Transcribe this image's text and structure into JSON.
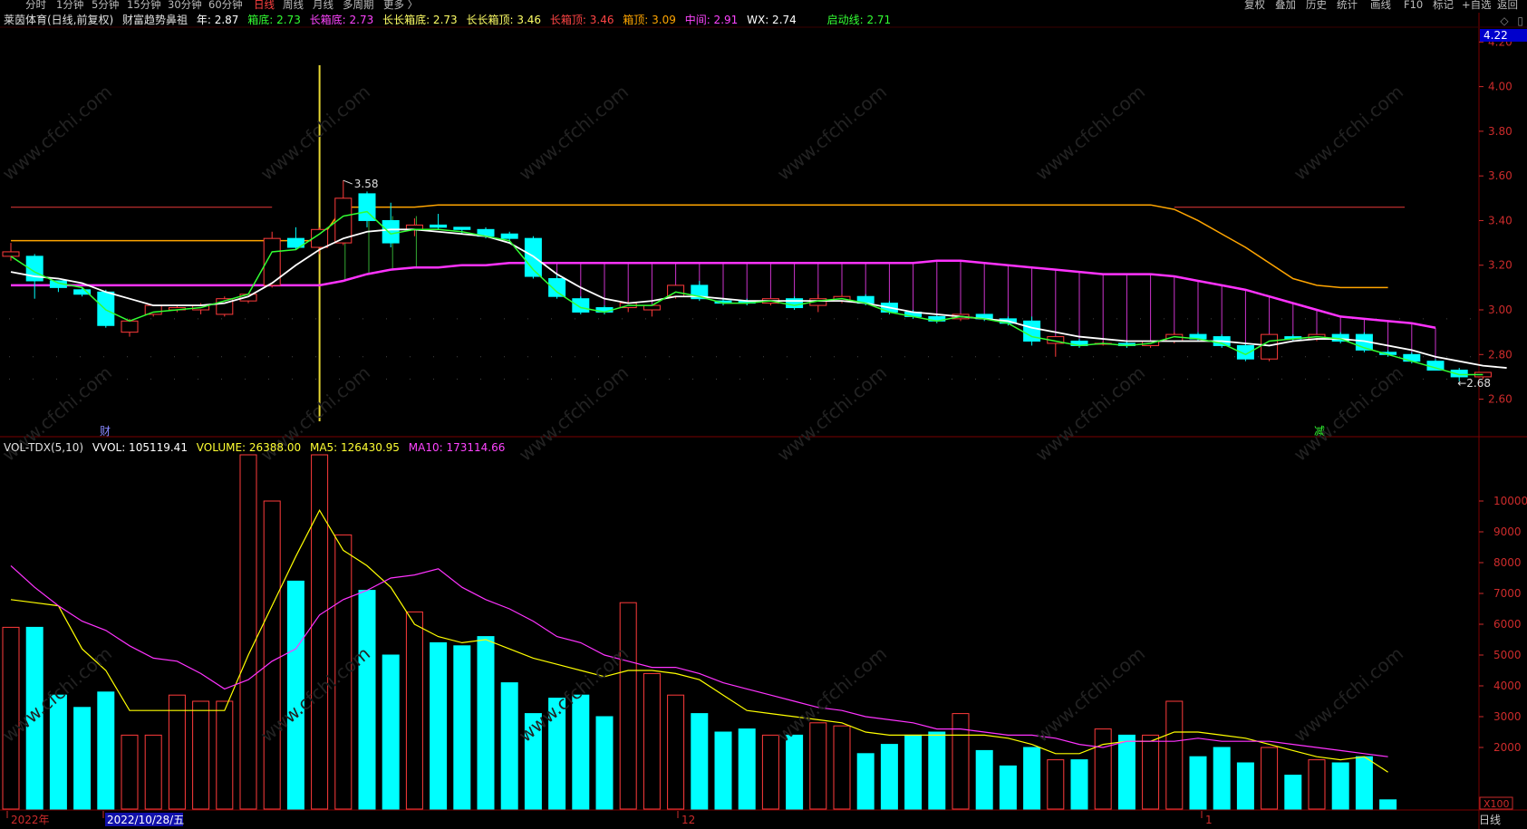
{
  "toolbar": {
    "left_items": [
      {
        "label": "分时",
        "x": 28
      },
      {
        "label": "1分钟",
        "x": 62
      },
      {
        "label": "5分钟",
        "x": 101
      },
      {
        "label": "15分钟",
        "x": 140
      },
      {
        "label": "30分钟",
        "x": 185
      },
      {
        "label": "60分钟",
        "x": 230
      },
      {
        "label": "日线",
        "x": 280,
        "active": true
      },
      {
        "label": "周线",
        "x": 312
      },
      {
        "label": "月线",
        "x": 345
      },
      {
        "label": "多周期",
        "x": 378
      },
      {
        "label": "更多 〉",
        "x": 423
      }
    ],
    "right_items": [
      {
        "label": "复权",
        "x": 1373
      },
      {
        "label": "叠加",
        "x": 1407
      },
      {
        "label": "历史",
        "x": 1441
      },
      {
        "label": "统计",
        "x": 1475
      },
      {
        "label": "画线",
        "x": 1512
      },
      {
        "label": "F10",
        "x": 1549
      },
      {
        "label": "标记",
        "x": 1581
      },
      {
        "label": "+自选",
        "x": 1613
      },
      {
        "label": "返回",
        "x": 1652
      }
    ]
  },
  "info": {
    "stock": "莱茵体育(日线,前复权)",
    "indicator": "财富趋势鼻祖",
    "year": "年: 2.87",
    "xiangdi": "箱底: 2.73",
    "long_xiangdi": "长箱底: 2.73",
    "longlong_xiangdi": "长长箱底: 2.73",
    "longlong_xiangding": "长长箱顶: 3.46",
    "long_xiangding": "长箱顶: 3.46",
    "xiangding": "箱顶: 3.09",
    "zhongjian": "中间: 2.91",
    "wx": "WX: 2.74",
    "qidong": "启动线: 2.71"
  },
  "vol_info": {
    "name": "VOL-TDX(5,10)",
    "vvol": "VVOL: 105119.41",
    "volume": "VOLUME: 26388.00",
    "ma5": "MA5: 126430.95",
    "ma10": "MA10: 173114.66"
  },
  "window_icons": [
    "diamond-icon",
    "restore-icon"
  ],
  "colors": {
    "bg": "#000000",
    "up": "#ff3b3b",
    "down": "#00ffff",
    "grid": "#5a0000",
    "white_line": "#ffffff",
    "green_line": "#33ff33",
    "orange_line": "#ffa500",
    "magenta_line": "#ff33ff",
    "darkred_line": "#cc3333",
    "yellow_line": "#ffff00",
    "axis_text": "#cc2b2b"
  },
  "chart_data": {
    "type": "candlestick",
    "price_axis": {
      "ticks": [
        "4.20",
        "4.00",
        "3.80",
        "3.60",
        "3.40",
        "3.20",
        "3.00",
        "2.80",
        "2.60"
      ],
      "ylim": [
        2.44,
        4.25
      ],
      "current_label": "4.22"
    },
    "volume_axis": {
      "ticks": [
        "10000",
        "9000",
        "8000",
        "7000",
        "6000",
        "5000",
        "4000",
        "3000",
        "2000"
      ],
      "unit": "X100",
      "ylim": [
        0,
        11500
      ]
    },
    "annotations": {
      "high": "3.58",
      "low": "2.68",
      "mark_left": "财",
      "mark_right": "减"
    },
    "date_labels": [
      "2022年",
      "2022/10/28/五",
      "12",
      "1"
    ],
    "timeframe": "日线",
    "candles": [
      [
        3.24,
        3.3,
        3.26,
        3.22
      ],
      [
        3.24,
        3.25,
        3.13,
        3.05
      ],
      [
        3.13,
        3.13,
        3.1,
        3.08
      ],
      [
        3.09,
        3.1,
        3.07,
        3.06
      ],
      [
        3.08,
        3.09,
        2.93,
        2.92
      ],
      [
        2.9,
        2.96,
        2.95,
        2.88
      ],
      [
        2.98,
        3.01,
        3.02,
        2.97
      ],
      [
        3.0,
        3.02,
        3.01,
        2.99
      ],
      [
        3.0,
        3.03,
        3.02,
        2.98
      ],
      [
        2.98,
        3.06,
        3.05,
        2.97
      ],
      [
        3.04,
        3.07,
        3.07,
        3.03
      ],
      [
        3.11,
        3.35,
        3.32,
        3.1
      ],
      [
        3.32,
        3.37,
        3.28,
        3.27
      ],
      [
        3.28,
        3.37,
        3.36,
        3.25
      ],
      [
        3.3,
        3.58,
        3.5,
        3.29
      ],
      [
        3.52,
        3.53,
        3.4,
        3.37
      ],
      [
        3.4,
        3.48,
        3.3,
        3.28
      ],
      [
        3.36,
        3.41,
        3.38,
        3.33
      ],
      [
        3.38,
        3.43,
        3.37,
        3.36
      ],
      [
        3.37,
        3.37,
        3.36,
        3.34
      ],
      [
        3.36,
        3.37,
        3.33,
        3.32
      ],
      [
        3.34,
        3.35,
        3.32,
        3.3
      ],
      [
        3.32,
        3.33,
        3.15,
        3.14
      ],
      [
        3.14,
        3.16,
        3.06,
        3.05
      ],
      [
        3.05,
        3.06,
        2.99,
        2.98
      ],
      [
        3.01,
        3.02,
        2.99,
        2.98
      ],
      [
        3.01,
        3.04,
        3.03,
        2.99
      ],
      [
        3.0,
        3.01,
        3.02,
        2.97
      ],
      [
        3.06,
        3.07,
        3.11,
        3.05
      ],
      [
        3.11,
        3.13,
        3.05,
        3.04
      ],
      [
        3.04,
        3.05,
        3.03,
        3.02
      ],
      [
        3.04,
        3.05,
        3.03,
        3.02
      ],
      [
        3.03,
        3.05,
        3.05,
        3.02
      ],
      [
        3.05,
        3.06,
        3.01,
        3.0
      ],
      [
        3.02,
        3.07,
        3.05,
        2.99
      ],
      [
        3.04,
        3.07,
        3.06,
        3.03
      ],
      [
        3.06,
        3.07,
        3.03,
        3.02
      ],
      [
        3.03,
        3.04,
        2.99,
        2.98
      ],
      [
        2.99,
        3.0,
        2.97,
        2.96
      ],
      [
        2.97,
        2.98,
        2.95,
        2.94
      ],
      [
        2.96,
        2.97,
        2.98,
        2.95
      ],
      [
        2.98,
        2.98,
        2.96,
        2.95
      ],
      [
        2.96,
        2.97,
        2.94,
        2.93
      ],
      [
        2.95,
        2.97,
        2.86,
        2.84
      ],
      [
        2.85,
        2.87,
        2.88,
        2.79
      ],
      [
        2.86,
        2.87,
        2.84,
        2.83
      ],
      [
        2.85,
        2.86,
        2.85,
        2.84
      ],
      [
        2.85,
        2.86,
        2.84,
        2.83
      ],
      [
        2.84,
        2.85,
        2.86,
        2.83
      ],
      [
        2.86,
        2.9,
        2.89,
        2.85
      ],
      [
        2.89,
        2.9,
        2.87,
        2.86
      ],
      [
        2.88,
        2.89,
        2.84,
        2.83
      ],
      [
        2.84,
        2.85,
        2.78,
        2.77
      ],
      [
        2.78,
        2.79,
        2.89,
        2.77
      ],
      [
        2.88,
        2.89,
        2.87,
        2.86
      ],
      [
        2.87,
        2.88,
        2.89,
        2.86
      ],
      [
        2.89,
        2.9,
        2.86,
        2.85
      ],
      [
        2.89,
        2.9,
        2.82,
        2.81
      ],
      [
        2.81,
        2.82,
        2.8,
        2.79
      ],
      [
        2.8,
        2.81,
        2.77,
        2.76
      ],
      [
        2.77,
        2.78,
        2.73,
        2.73
      ],
      [
        2.73,
        2.74,
        2.7,
        2.68
      ],
      [
        2.7,
        2.71,
        2.72,
        2.69
      ]
    ],
    "volumes": [
      5900,
      5900,
      3700,
      3300,
      3800,
      2400,
      2400,
      3700,
      3500,
      3500,
      11500,
      10000,
      7400,
      11500,
      8900,
      7100,
      5000,
      6400,
      5400,
      5300,
      5600,
      4100,
      3100,
      3600,
      3700,
      3000,
      6700,
      4400,
      3700,
      3100,
      2500,
      2600,
      2400,
      2400,
      2800,
      2700,
      1800,
      2100,
      2400,
      2500,
      3100,
      1900,
      1400,
      2000,
      1600,
      1600,
      2600,
      2400,
      2400,
      3500,
      1700,
      2000,
      1500,
      2000,
      1100,
      1600,
      1500,
      1700,
      300
    ],
    "ma5": [
      6800,
      6700,
      6600,
      5200,
      4500,
      3200,
      3200,
      3200,
      3200,
      3200,
      5000,
      6600,
      8200,
      9700,
      8400,
      7900,
      7200,
      6000,
      5600,
      5400,
      5500,
      5200,
      4900,
      4700,
      4500,
      4300,
      4500,
      4500,
      4400,
      4200,
      3700,
      3200,
      3100,
      3000,
      2900,
      2800,
      2500,
      2400,
      2400,
      2400,
      2400,
      2400,
      2300,
      2100,
      1800,
      1800,
      2100,
      2200,
      2200,
      2500,
      2500,
      2400,
      2300,
      2100,
      1900,
      1700,
      1600,
      1700,
      1200
    ],
    "ma10": [
      7900,
      7200,
      6600,
      6100,
      5800,
      5300,
      4900,
      4800,
      4400,
      3900,
      4200,
      4800,
      5200,
      6300,
      6800,
      7100,
      7500,
      7600,
      7800,
      7200,
      6800,
      6500,
      6100,
      5600,
      5400,
      5000,
      4800,
      4600,
      4600,
      4400,
      4100,
      3900,
      3700,
      3500,
      3300,
      3200,
      3000,
      2900,
      2800,
      2600,
      2600,
      2500,
      2400,
      2400,
      2300,
      2100,
      2000,
      2200,
      2200,
      2200,
      2300,
      2200,
      2200,
      2200,
      2100,
      2000,
      1900,
      1800,
      1700
    ],
    "white_line": [
      3.17,
      3.15,
      3.14,
      3.12,
      3.08,
      3.05,
      3.02,
      3.02,
      3.02,
      3.03,
      3.06,
      3.12,
      3.2,
      3.27,
      3.32,
      3.35,
      3.36,
      3.36,
      3.35,
      3.34,
      3.33,
      3.3,
      3.24,
      3.16,
      3.1,
      3.05,
      3.03,
      3.04,
      3.06,
      3.06,
      3.05,
      3.04,
      3.04,
      3.04,
      3.04,
      3.04,
      3.03,
      3.01,
      2.99,
      2.98,
      2.97,
      2.96,
      2.95,
      2.92,
      2.9,
      2.88,
      2.87,
      2.86,
      2.86,
      2.86,
      2.86,
      2.86,
      2.85,
      2.84,
      2.86,
      2.87,
      2.87,
      2.86,
      2.84,
      2.82,
      2.79,
      2.77,
      2.75,
      2.74
    ],
    "green_line": [
      3.24,
      3.17,
      3.12,
      3.1,
      3.0,
      2.95,
      2.99,
      3.0,
      3.01,
      3.04,
      3.07,
      3.26,
      3.27,
      3.34,
      3.42,
      3.44,
      3.34,
      3.36,
      3.36,
      3.35,
      3.33,
      3.31,
      3.18,
      3.08,
      3.01,
      2.99,
      3.02,
      3.02,
      3.08,
      3.06,
      3.03,
      3.03,
      3.04,
      3.02,
      3.04,
      3.05,
      3.03,
      2.99,
      2.97,
      2.95,
      2.97,
      2.96,
      2.94,
      2.88,
      2.86,
      2.84,
      2.85,
      2.84,
      2.85,
      2.88,
      2.87,
      2.85,
      2.8,
      2.86,
      2.87,
      2.88,
      2.87,
      2.83,
      2.8,
      2.77,
      2.74,
      2.71,
      2.71
    ],
    "orange_line": [
      3.31,
      3.31,
      3.31,
      3.31,
      3.31,
      3.31,
      3.31,
      3.31,
      3.31,
      3.31,
      3.31,
      3.31,
      3.31,
      3.31,
      3.46,
      3.46,
      3.46,
      3.46,
      3.47,
      3.47,
      3.47,
      3.47,
      3.47,
      3.47,
      3.47,
      3.47,
      3.47,
      3.47,
      3.47,
      3.47,
      3.47,
      3.47,
      3.47,
      3.47,
      3.47,
      3.47,
      3.47,
      3.47,
      3.47,
      3.47,
      3.47,
      3.47,
      3.47,
      3.47,
      3.47,
      3.47,
      3.47,
      3.47,
      3.47,
      3.45,
      3.4,
      3.34,
      3.28,
      3.21,
      3.14,
      3.11,
      3.1,
      3.1,
      3.1
    ],
    "magenta_line": [
      3.11,
      3.11,
      3.11,
      3.11,
      3.11,
      3.11,
      3.11,
      3.11,
      3.11,
      3.11,
      3.11,
      3.11,
      3.11,
      3.11,
      3.13,
      3.16,
      3.18,
      3.19,
      3.19,
      3.2,
      3.2,
      3.21,
      3.21,
      3.21,
      3.21,
      3.21,
      3.21,
      3.21,
      3.21,
      3.21,
      3.21,
      3.21,
      3.21,
      3.21,
      3.21,
      3.21,
      3.21,
      3.21,
      3.21,
      3.22,
      3.22,
      3.21,
      3.2,
      3.19,
      3.18,
      3.17,
      3.16,
      3.16,
      3.16,
      3.15,
      3.13,
      3.11,
      3.09,
      3.06,
      3.03,
      3.0,
      2.97,
      2.96,
      2.95,
      2.94,
      2.92
    ],
    "darkred_line": [
      3.46,
      3.46,
      3.46,
      3.46,
      3.46,
      3.46,
      3.46,
      3.46,
      3.46,
      3.46,
      3.46,
      3.46
    ]
  }
}
